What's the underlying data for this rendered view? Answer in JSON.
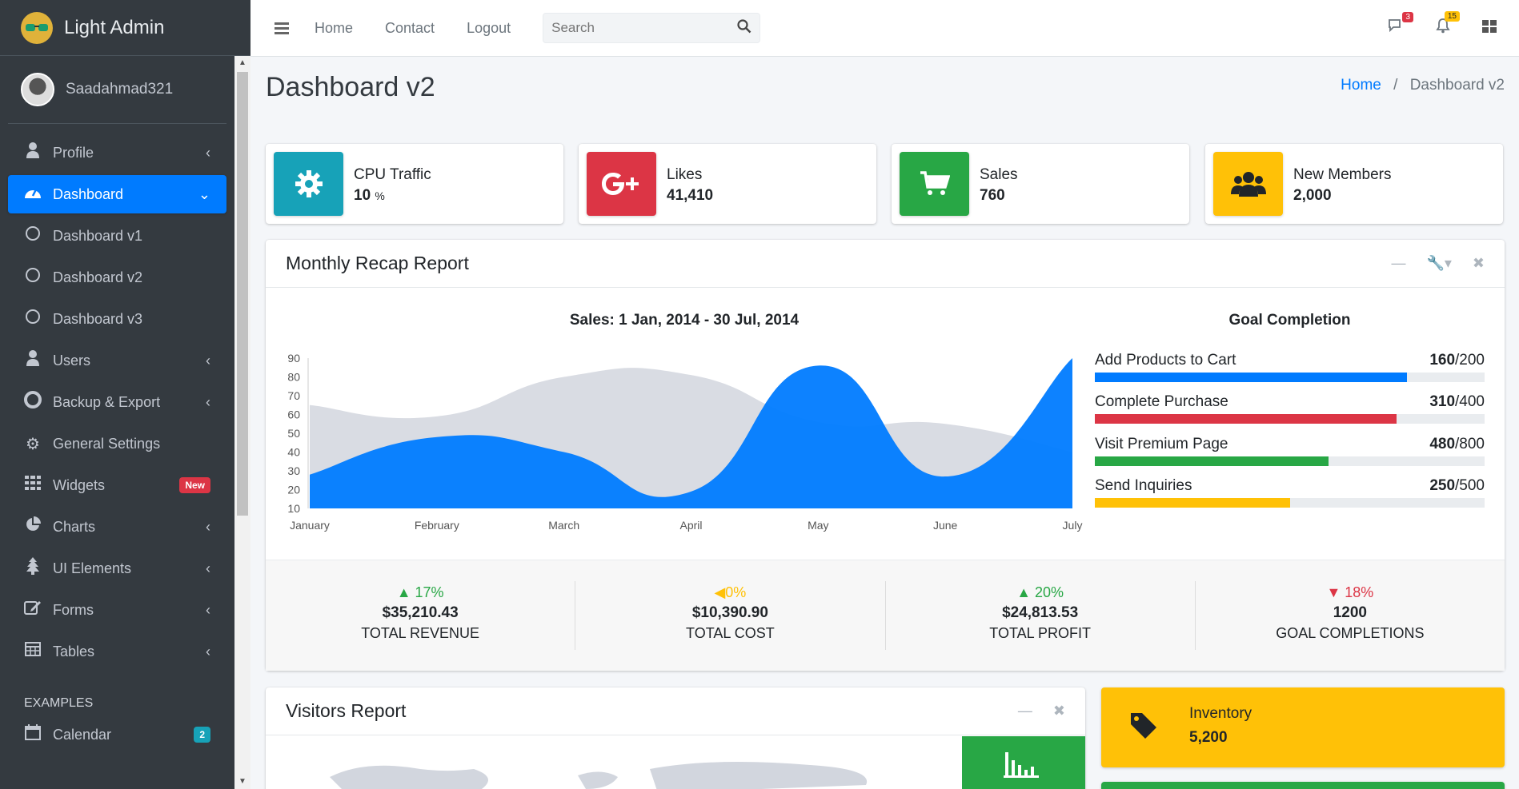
{
  "brand": {
    "name": "Light Admin"
  },
  "user": {
    "name": "Saadahmad321"
  },
  "sidebar": {
    "items": [
      {
        "label": "Profile",
        "icon": "user-icon"
      },
      {
        "label": "Dashboard",
        "icon": "tachometer-icon",
        "active": true
      },
      {
        "label": "Dashboard v1",
        "icon": "circle-icon"
      },
      {
        "label": "Dashboard v2",
        "icon": "circle-icon"
      },
      {
        "label": "Dashboard v3",
        "icon": "circle-icon"
      },
      {
        "label": "Users",
        "icon": "user-icon"
      },
      {
        "label": "Backup & Export",
        "icon": "life-ring-icon"
      },
      {
        "label": "General Settings",
        "icon": "gears-icon"
      },
      {
        "label": "Widgets",
        "icon": "grid-icon",
        "badge": "New"
      },
      {
        "label": "Charts",
        "icon": "pie-chart-icon"
      },
      {
        "label": "UI Elements",
        "icon": "tree-icon"
      },
      {
        "label": "Forms",
        "icon": "edit-icon"
      },
      {
        "label": "Tables",
        "icon": "table-icon"
      }
    ],
    "section_header": "EXAMPLES",
    "calendar": {
      "label": "Calendar",
      "badge": "2"
    }
  },
  "topbar": {
    "links": [
      "Home",
      "Contact",
      "Logout"
    ],
    "search_placeholder": "Search",
    "messages_count": "3",
    "notifications_count": "15"
  },
  "page": {
    "title": "Dashboard v2",
    "breadcrumb_home": "Home",
    "breadcrumb_current": "Dashboard v2"
  },
  "info_boxes": [
    {
      "label": "CPU Traffic",
      "value": "10",
      "unit": "%",
      "color": "#17a2b8",
      "icon": "gear-icon"
    },
    {
      "label": "Likes",
      "value": "41,410",
      "color": "#dc3545",
      "icon": "google-plus-icon"
    },
    {
      "label": "Sales",
      "value": "760",
      "color": "#28a745",
      "icon": "shopping-cart-icon"
    },
    {
      "label": "New Members",
      "value": "2,000",
      "color": "#ffc107",
      "icon": "users-icon"
    }
  ],
  "recap": {
    "title": "Monthly Recap Report",
    "chart_title": "Sales: 1 Jan, 2014 - 30 Jul, 2014",
    "goal_title": "Goal Completion",
    "goals": [
      {
        "label": "Add Products to Cart",
        "value": "160",
        "total": "/200",
        "fraction": 0.8,
        "color": "#007bff"
      },
      {
        "label": "Complete Purchase",
        "value": "310",
        "total": "/400",
        "fraction": 0.775,
        "color": "#dc3545"
      },
      {
        "label": "Visit Premium Page",
        "value": "480",
        "total": "/800",
        "fraction": 0.6,
        "color": "#28a745"
      },
      {
        "label": "Send Inquiries",
        "value": "250",
        "total": "/500",
        "fraction": 0.5,
        "color": "#ffc107"
      }
    ],
    "stats": [
      {
        "pct": "17%",
        "trend": "up",
        "color": "#28a745",
        "amount": "$35,210.43",
        "label": "TOTAL REVENUE"
      },
      {
        "pct": "0%",
        "trend": "left",
        "color": "#ffc107",
        "amount": "$10,390.90",
        "label": "TOTAL COST"
      },
      {
        "pct": "20%",
        "trend": "up",
        "color": "#28a745",
        "amount": "$24,813.53",
        "label": "TOTAL PROFIT"
      },
      {
        "pct": "18%",
        "trend": "down",
        "color": "#dc3545",
        "amount": "1200",
        "label": "GOAL COMPLETIONS"
      }
    ]
  },
  "chart_data": {
    "type": "area",
    "title": "Sales: 1 Jan, 2014 - 30 Jul, 2014",
    "categories": [
      "January",
      "February",
      "March",
      "April",
      "May",
      "June",
      "July"
    ],
    "ylim": [
      10,
      90
    ],
    "yticks": [
      10,
      20,
      30,
      40,
      50,
      60,
      70,
      80,
      90
    ],
    "grid": false,
    "series": [
      {
        "values": [
          65,
          59,
          80,
          81,
          56,
          55,
          40
        ],
        "color": "#d2d6de"
      },
      {
        "values": [
          28,
          48,
          40,
          19,
          86,
          27,
          90
        ],
        "color": "#007bff"
      }
    ]
  },
  "visitors": {
    "title": "Visitors Report"
  },
  "inventory": {
    "label": "Inventory",
    "value": "5,200",
    "color": "#ffc107",
    "icon": "tag-icon"
  }
}
